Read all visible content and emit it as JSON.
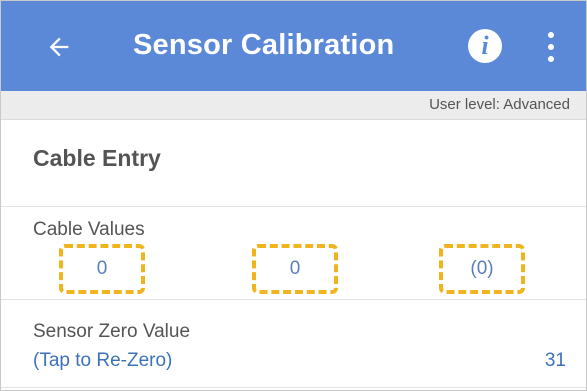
{
  "appbar": {
    "title": "Sensor Calibration",
    "back_icon": "arrow-left-icon",
    "info_icon": "info-icon",
    "info_glyph": "i",
    "overflow_icon": "more-vertical-icon",
    "color": "#5b89d8"
  },
  "user_level": {
    "text": "User level: Advanced"
  },
  "section": {
    "title": "Cable Entry"
  },
  "cable_values": {
    "label": "Cable Values",
    "values": [
      "0",
      "0",
      "(0)"
    ],
    "highlight_color": "#f0b51e"
  },
  "sensor_zero": {
    "label": "Sensor Zero Value",
    "action": "(Tap to Re-Zero)",
    "value": "31"
  }
}
